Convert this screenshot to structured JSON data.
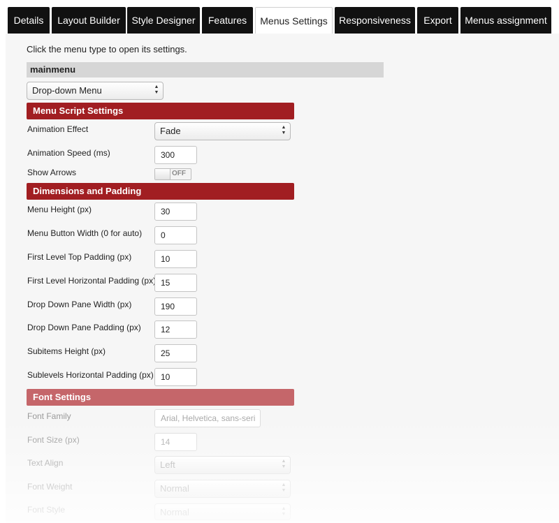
{
  "tabs": [
    {
      "label": "Details"
    },
    {
      "label": "Layout Builder"
    },
    {
      "label": "Style Designer"
    },
    {
      "label": "Features"
    },
    {
      "label": "Menus Settings"
    },
    {
      "label": "Responsiveness"
    },
    {
      "label": "Export"
    },
    {
      "label": "Menus assignment"
    }
  ],
  "active_tab": "Menus Settings",
  "intro": "Click the menu type to open its settings.",
  "menu": {
    "name": "mainmenu",
    "type": "Drop-down Menu"
  },
  "script_settings": {
    "header": "Menu Script Settings",
    "animation_effect_label": "Animation Effect",
    "animation_effect_value": "Fade",
    "animation_speed_label": "Animation Speed (ms)",
    "animation_speed_value": "300",
    "show_arrows_label": "Show Arrows",
    "show_arrows_state": "OFF"
  },
  "dimensions": {
    "header": "Dimensions and Padding",
    "fields": [
      {
        "label": "Menu Height (px)",
        "value": "30"
      },
      {
        "label": "Menu Button Width (0 for auto)",
        "value": "0"
      },
      {
        "label": "First Level Top Padding (px)",
        "value": "10"
      },
      {
        "label": "First Level Horizontal Padding (px)",
        "value": "15"
      },
      {
        "label": "Drop Down Pane Width (px)",
        "value": "190"
      },
      {
        "label": "Drop Down Pane Padding (px)",
        "value": "12"
      },
      {
        "label": "Subitems Height (px)",
        "value": "25"
      },
      {
        "label": "Sublevels Horizontal Padding (px)",
        "value": "10"
      }
    ]
  },
  "font_settings": {
    "header": "Font Settings",
    "font_family_label": "Font Family",
    "font_family_value": "Arial, Helvetica, sans-seri",
    "font_size_label": "Font Size (px)",
    "font_size_value": "14",
    "text_align_label": "Text Align",
    "text_align_value": "Left",
    "font_weight_label": "Font Weight",
    "font_weight_value": "Normal",
    "font_style_label": "Font Style",
    "font_style_value": "Normal"
  },
  "colors": {
    "tab_bg": "#111111",
    "section_header": "#a11e22",
    "section_header_faded": "#c5666a",
    "panel_bg": "#f6f6f6"
  }
}
